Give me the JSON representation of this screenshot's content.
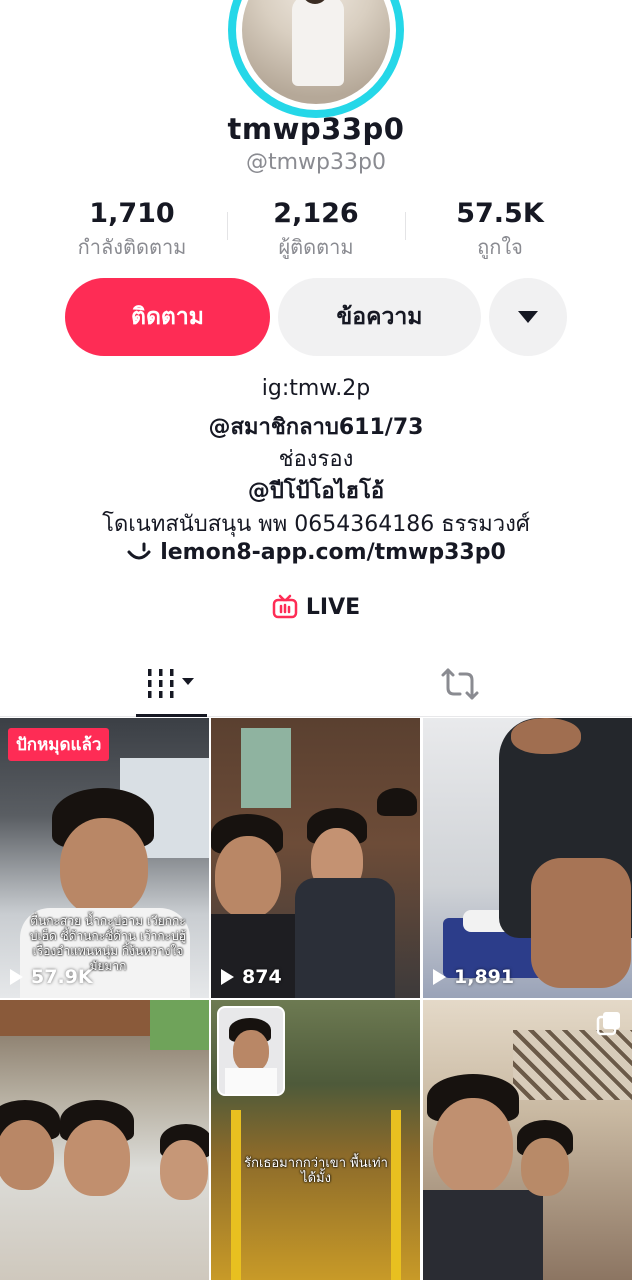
{
  "profile": {
    "display_name": "tmwp33p0",
    "handle": "@tmwp33p0"
  },
  "stats": [
    {
      "value": "1,710",
      "label": "กำลังติดตาม"
    },
    {
      "value": "2,126",
      "label": "ผู้ติดตาม"
    },
    {
      "value": "57.5K",
      "label": "ถูกใจ"
    }
  ],
  "actions": {
    "follow_label": "ติดตาม",
    "message_label": "ข้อความ",
    "more_icon": "caret-down-icon"
  },
  "bio": {
    "line1": "ig:tmw.2p",
    "line2": "@สมาชิกลาบ611/73",
    "line3": "ช่องรอง",
    "line4": "@ปีโป้โอไฮโอ้",
    "line5": "โดเนทสนับสนุน พพ 0654364186 ธรรมวงศ์"
  },
  "link": {
    "icon": "lemon8-icon",
    "text": "lemon8-app.com/tmwp33p0"
  },
  "live": {
    "icon": "live-tv-icon",
    "text": "LIVE"
  },
  "tabs": [
    {
      "icon": "grid-videos-icon",
      "active": true
    },
    {
      "icon": "repost-icon",
      "active": false
    }
  ],
  "videos": [
    {
      "views": "57.9K",
      "pinned": true,
      "pin_label": "ปักหมุดแล้ว",
      "caption": "ตื่นกะสวย น้ำกะบ่อาม เวียกกะบ่เฮ็ด ซี้ด้านกะซี้ด้าน เว้ากะบ่ฮู้เรื่องอำแพนหนุ่ม กิ้ง้นหวางใจมัยมาก"
    },
    {
      "views": "874"
    },
    {
      "views": "1,891"
    },
    {
      "caption": "รักเธอมากกว่าเขา พื้นเท่าได้มั้ง"
    },
    {},
    {
      "multi_icon": "multi-photo-icon"
    }
  ],
  "colors": {
    "accent": "#fe2c55",
    "avatar_ring": "#25d7e8"
  }
}
